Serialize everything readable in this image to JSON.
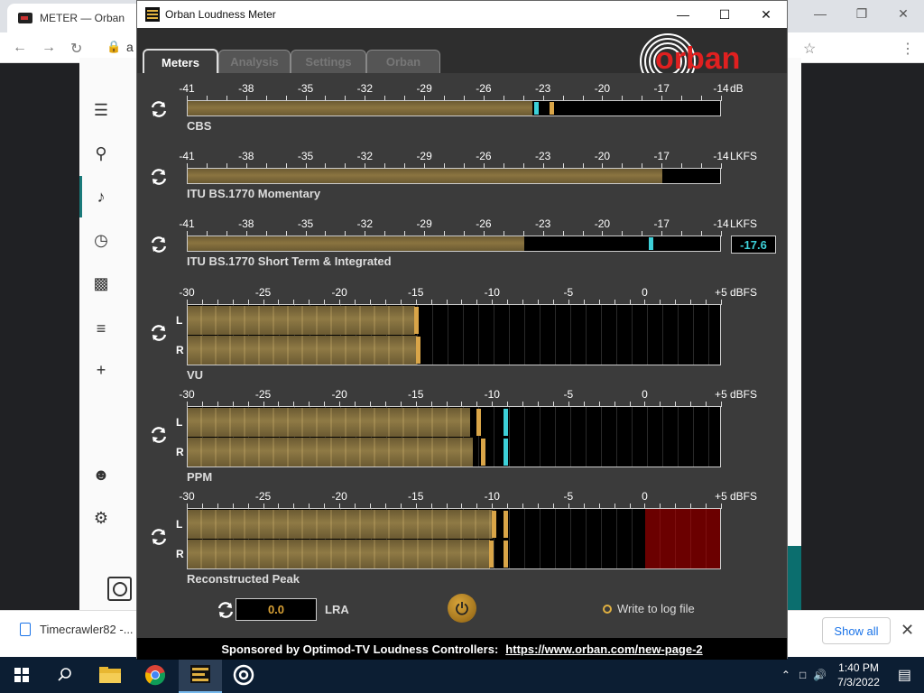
{
  "browser": {
    "tab_title": "METER — Orban",
    "address_partial": "a",
    "download_item": "Timecrawler82 -...",
    "show_all": "Show all"
  },
  "window": {
    "title": "Orban Loudness Meter"
  },
  "tabs": [
    {
      "label": "Meters",
      "active": true
    },
    {
      "label": "Analysis",
      "active": false
    },
    {
      "label": "Settings",
      "active": false
    },
    {
      "label": "Orban",
      "active": false
    }
  ],
  "logo_text": "orban",
  "meters": {
    "cbs": {
      "scale": [
        "-41",
        "-38",
        "-35",
        "-32",
        "-29",
        "-26",
        "-23",
        "-20",
        "-17",
        "-14"
      ],
      "unit": "dB",
      "label": "CBS",
      "level_db": -23.6,
      "cyan_marker_db": -23.6,
      "peak_hold_db": -22.6
    },
    "momentary": {
      "scale": [
        "-41",
        "-38",
        "-35",
        "-32",
        "-29",
        "-26",
        "-23",
        "-20",
        "-17",
        "-14"
      ],
      "unit": "LKFS",
      "label": "ITU BS.1770 Momentary",
      "level_lkfs": -17.0,
      "peak_hold_lkfs": -17.0
    },
    "short_term": {
      "scale": [
        "-41",
        "-38",
        "-35",
        "-32",
        "-29",
        "-26",
        "-23",
        "-20",
        "-17",
        "-14"
      ],
      "unit": "LKFS",
      "label": "ITU BS.1770 Short Term & Integrated",
      "level_lkfs": -24.0,
      "integrated_marker_lkfs": -17.6,
      "readout": "-17.6"
    },
    "vu": {
      "scale": [
        "-30",
        "-25",
        "-20",
        "-15",
        "-10",
        "-5",
        "0",
        "+5"
      ],
      "unit": "dBFS",
      "label": "VU",
      "left_db": -15.1,
      "right_db": -15.0
    },
    "ppm": {
      "scale": [
        "-30",
        "-25",
        "-20",
        "-15",
        "-10",
        "-5",
        "0",
        "+5"
      ],
      "unit": "dBFS",
      "label": "PPM",
      "left_db": -11.5,
      "right_db": -11.3,
      "left_peak_db": -11.0,
      "right_peak_db": -10.7,
      "left_hold_db": -9.2,
      "right_hold_db": -9.2
    },
    "reconstructed_peak": {
      "scale": [
        "-30",
        "-25",
        "-20",
        "-15",
        "-10",
        "-5",
        "0",
        "+5"
      ],
      "unit": "dBFS",
      "label": "Reconstructed Peak",
      "left_db": -10.0,
      "right_db": -10.2,
      "left_hold_db": -9.2,
      "right_hold_db": -9.2,
      "over_zone_start_db": 0
    }
  },
  "lra": {
    "value": "0.0",
    "label": "LRA"
  },
  "log_option": "Write to log file",
  "footer": {
    "text": "Sponsored by Optimod-TV Loudness Controllers:",
    "link": "https://www.orban.com/new-page-2"
  },
  "tray": {
    "time": "1:40 PM",
    "date": "7/3/2022"
  }
}
